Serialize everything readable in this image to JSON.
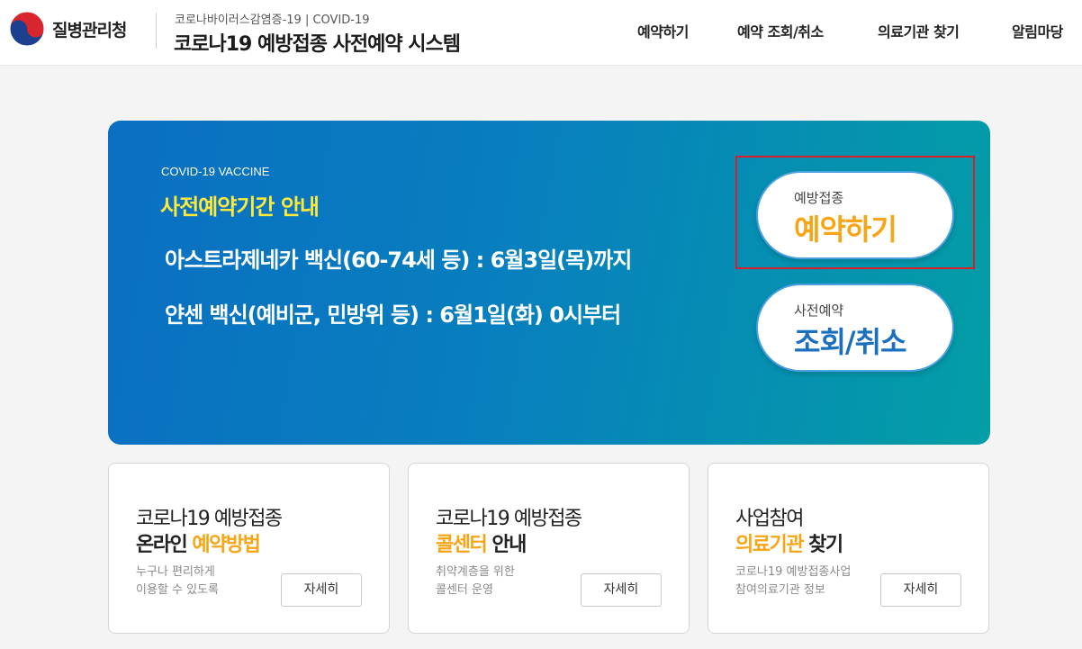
{
  "header": {
    "logo_text": "질병관리청",
    "subtitle": "코로나바이러스감염증-19 | COVID-19",
    "system_title": "코로나19 예방접종 사전예약 시스템",
    "nav": [
      {
        "label": "예약하기"
      },
      {
        "label": "예약 조회/취소"
      },
      {
        "label": "의료기관 찾기"
      },
      {
        "label": "알림마당"
      }
    ]
  },
  "banner": {
    "eyebrow": "COVID-19 VACCINE",
    "title": "사전예약기간 안내",
    "line1": "아스트라제네카 백신(60-74세 등) : 6월3일(목)까지",
    "line2": "얀센 백신(예비군, 민방위 등) : 6월1일(화) 0시부터",
    "reserve_small": "예방접종",
    "reserve_big": "예약하기",
    "lookup_small": "사전예약",
    "lookup_big": "조회/취소"
  },
  "cards": [
    {
      "line1": "코로나19 예방접종",
      "line2_plain_before": "온라인 ",
      "line2_highlight": "예약방법",
      "line2_plain_after": "",
      "desc1": "누구나 편리하게",
      "desc2": "이용할 수 있도록",
      "button": "자세히"
    },
    {
      "line1": "코로나19 예방접종",
      "line2_plain_before": "",
      "line2_highlight": "콜센터",
      "line2_plain_after": " 안내",
      "desc1": "취약계층을 위한",
      "desc2": "콜센터 운영",
      "button": "자세히"
    },
    {
      "line1": "사업참여",
      "line2_plain_before": "",
      "line2_highlight": "의료기관",
      "line2_plain_after": " 찾기",
      "desc1": "코로나19 예방접종사업",
      "desc2": "참여의료기관 정보",
      "button": "자세히"
    }
  ],
  "colors": {
    "accent_orange": "#f7a515",
    "accent_blue": "#1a6fbf",
    "banner_title_yellow": "#ffe93a",
    "highlight_red": "#d6202a"
  },
  "icons": {
    "logo": "taegeuk-emblem-icon"
  }
}
